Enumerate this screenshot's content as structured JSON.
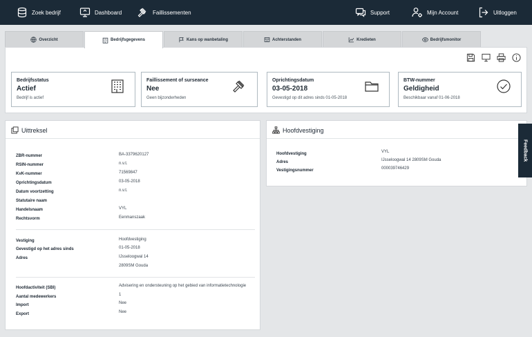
{
  "topnav": {
    "search": "Zoek bedrijf",
    "dashboard": "Dashboard",
    "faillissementen": "Faillissementen",
    "support": "Support",
    "account": "Mijn Account",
    "logout": "Uitloggen"
  },
  "tabs": [
    {
      "label": "Overzicht",
      "icon": "globe-icon"
    },
    {
      "label": "Bedrijfsgegevens",
      "icon": "building-icon"
    },
    {
      "label": "Kans op wanbetaling",
      "icon": "flag-icon"
    },
    {
      "label": "Achterstanden",
      "icon": "calculator-icon"
    },
    {
      "label": "Kredieten",
      "icon": "chart-icon"
    },
    {
      "label": "Bedrijfsmonitor",
      "icon": "eye-icon"
    }
  ],
  "cards": [
    {
      "title": "Bedrijfsstatus",
      "value": "Actief",
      "sub": "Bedrijf is actief",
      "icon": "building-icon"
    },
    {
      "title": "Faillissement of surseance",
      "value": "Nee",
      "sub": "Geen bijzonderheden",
      "icon": "gavel-icon"
    },
    {
      "title": "Oprichtingsdatum",
      "value": "03-05-2018",
      "sub": "Gevestigd op dit adres sinds 01-05-2018",
      "icon": "folder-icon"
    },
    {
      "title": "BTW-nummer",
      "value": "Geldigheid",
      "sub": "Beschikbaar vanaf 01-06-2018",
      "icon": "check-circle-icon"
    }
  ],
  "uittreksel": {
    "title": "Uittreksel",
    "group1": [
      {
        "k": "ZBR-nummer",
        "v": "BA-3379620127"
      },
      {
        "k": "RSIN-nummer",
        "v": "n.v.t."
      },
      {
        "k": "KvK-nummer",
        "v": "71569847"
      },
      {
        "k": "Oprichtingsdatum",
        "v": "03-05-2018"
      },
      {
        "k": "Datum voortzetting",
        "v": "n.v.t."
      },
      {
        "k": "Statutaire naam",
        "v": ""
      },
      {
        "k": "Handelsnaam",
        "v": "VYL"
      },
      {
        "k": "Rechtsvorm",
        "v": "Eenmanszaak"
      }
    ],
    "group2": [
      {
        "k": "Vestiging",
        "v": "Hoofdvestiging"
      },
      {
        "k": "Gevestigd op het adres sinds",
        "v": "01-05-2018"
      },
      {
        "k": "Adres",
        "v": "IJsseloogwal 14"
      },
      {
        "k": "",
        "v": "2809SM Gouda"
      }
    ],
    "group3": [
      {
        "k": "Hoofdactiviteit (SBI)",
        "v": "Advisering en ondersteuning op het gebied van informatietechnologie"
      },
      {
        "k": "Aantal medewerkers",
        "v": "1"
      },
      {
        "k": "Import",
        "v": "Nee"
      },
      {
        "k": "Export",
        "v": "Nee"
      }
    ]
  },
  "hoofdvestiging": {
    "title": "Hoofdvestiging",
    "rows": [
      {
        "k": "Hoofdvestiging",
        "v": "VYL"
      },
      {
        "k": "Adres",
        "v": "IJsseloogwal 14 2809SM Gouda"
      },
      {
        "k": "Vestigingsnummer",
        "v": "000039746429"
      }
    ]
  },
  "feedback": "Feedback"
}
